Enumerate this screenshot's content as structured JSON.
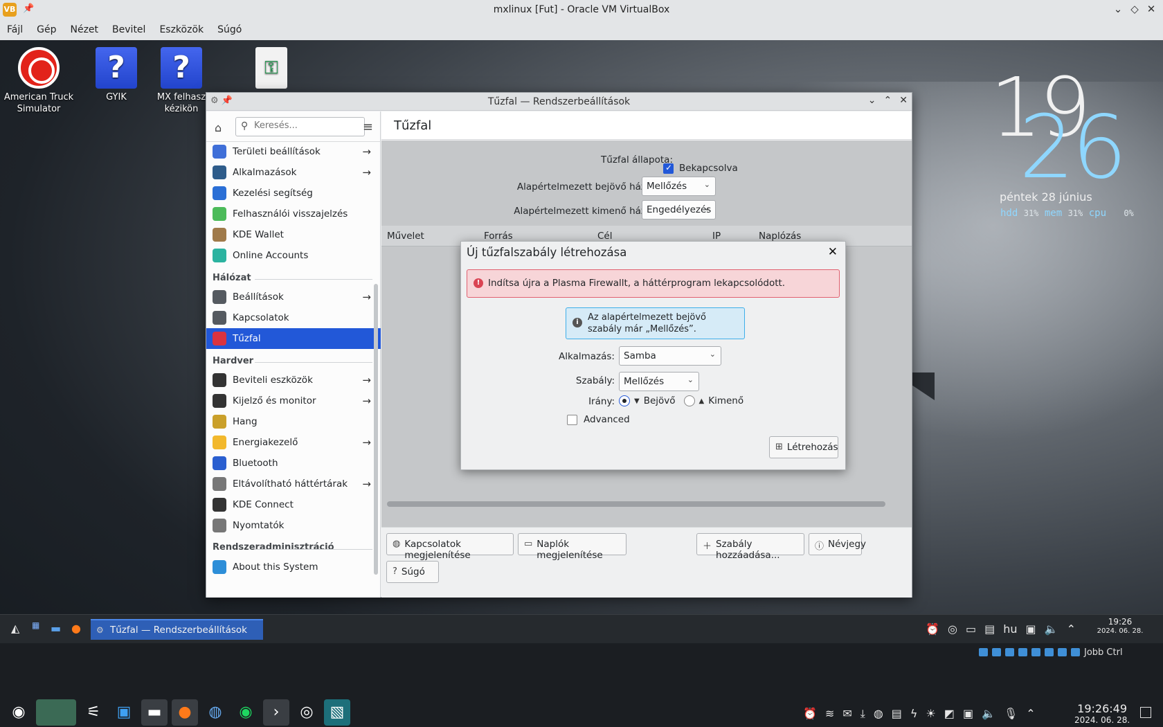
{
  "host": {
    "title": "mxlinux [Fut] - Oracle VM VirtualBox",
    "menu": [
      "Fájl",
      "Gép",
      "Nézet",
      "Bevitel",
      "Eszközök",
      "Súgó"
    ]
  },
  "desktop_icons": [
    {
      "label": "American Truck Simulator",
      "icon": "steering-wheel-icon"
    },
    {
      "label": "GYIK",
      "icon": "help-icon"
    },
    {
      "label": "MX felhasz kézikön",
      "icon": "help-icon"
    },
    {
      "label": "",
      "icon": "key-file-icon"
    }
  ],
  "clock_widget": {
    "hours": "19",
    "minutes": "26",
    "date": "péntek  28 június",
    "stats": [
      {
        "name": "hdd",
        "value": "31%"
      },
      {
        "name": "mem",
        "value": "31%"
      },
      {
        "name": "cpu",
        "value": "0%"
      }
    ]
  },
  "window": {
    "title": "Tűzfal — Rendszerbeállítások",
    "search_placeholder": "Keresés...",
    "page_title": "Tűzfal",
    "sidebar": {
      "items_top": [
        {
          "label": "Területi beállítások",
          "arrow": true,
          "color": "#3f6fd8"
        },
        {
          "label": "Alkalmazások",
          "arrow": true,
          "color": "#2e5c8a"
        },
        {
          "label": "Kezelési segítség",
          "arrow": false,
          "color": "#2a6fd6"
        },
        {
          "label": "Felhasználói visszajelzés",
          "arrow": false,
          "color": "#4cbb5a"
        },
        {
          "label": "KDE Wallet",
          "arrow": false,
          "color": "#a07a4a"
        },
        {
          "label": "Online Accounts",
          "arrow": false,
          "color": "#2bb3a0"
        }
      ],
      "section_network": "Hálózat",
      "items_network": [
        {
          "label": "Beállítások",
          "arrow": true,
          "color": "#555a60"
        },
        {
          "label": "Kapcsolatok",
          "arrow": false,
          "color": "#555a60"
        },
        {
          "label": "Tűzfal",
          "arrow": false,
          "color": "#da3340"
        }
      ],
      "section_hardware": "Hardver",
      "items_hardware": [
        {
          "label": "Beviteli eszközök",
          "arrow": true,
          "color": "#333"
        },
        {
          "label": "Kijelző és monitor",
          "arrow": true,
          "color": "#333"
        },
        {
          "label": "Hang",
          "arrow": false,
          "color": "#caa02a"
        },
        {
          "label": "Energiakezelő",
          "arrow": true,
          "color": "#f2b82c"
        },
        {
          "label": "Bluetooth",
          "arrow": false,
          "color": "#2a5fd0"
        },
        {
          "label": "Eltávolítható háttértárak",
          "arrow": true,
          "color": "#777"
        },
        {
          "label": "KDE Connect",
          "arrow": false,
          "color": "#333"
        },
        {
          "label": "Nyomtatók",
          "arrow": false,
          "color": "#777"
        }
      ],
      "section_admin": "Rendszeradminisztráció",
      "items_admin": [
        {
          "label": "About this System",
          "arrow": false,
          "color": "#2d8ed8"
        }
      ]
    },
    "firewall": {
      "status_label": "Tűzfal állapota:",
      "status_value": "Bekapcsolva",
      "incoming_label": "Alapértelmezett bejövő házirend:",
      "incoming_value": "Mellőzés",
      "outgoing_label": "Alapértelmezett kimenő házirend:",
      "outgoing_value": "Engedélyezés",
      "columns": [
        "Művelet",
        "Forrás",
        "Cél",
        "IP",
        "Naplózás"
      ]
    },
    "buttons": {
      "connections": "Kapcsolatok megjelenítése",
      "logs": "Naplók megjelenítése",
      "add_rule": "Szabály hozzáadása...",
      "about": "Névjegy",
      "help": "Súgó"
    }
  },
  "dialog": {
    "title": "Új tűzfalszabály létrehozása",
    "error": "Indítsa újra a Plasma Firewallt, a háttérprogram lekapcsolódott.",
    "info": "Az alapértelmezett bejövő szabály már „Mellőzés”.",
    "app_label": "Alkalmazás:",
    "app_value": "Samba",
    "rule_label": "Szabály:",
    "rule_value": "Mellőzés",
    "direction_label": "Irány:",
    "incoming": "Bejövő",
    "outgoing": "Kimenő",
    "advanced": "Advanced",
    "create": "Létrehozás"
  },
  "panel": {
    "task": "Tűzfal  — Rendszerbeállítások",
    "lang": "hu",
    "time": "19:26",
    "date": "2024. 06. 28."
  },
  "host_bar": {
    "right_label": "Jobb Ctrl",
    "time": "19:26:49",
    "date": "2024. 06. 28."
  }
}
